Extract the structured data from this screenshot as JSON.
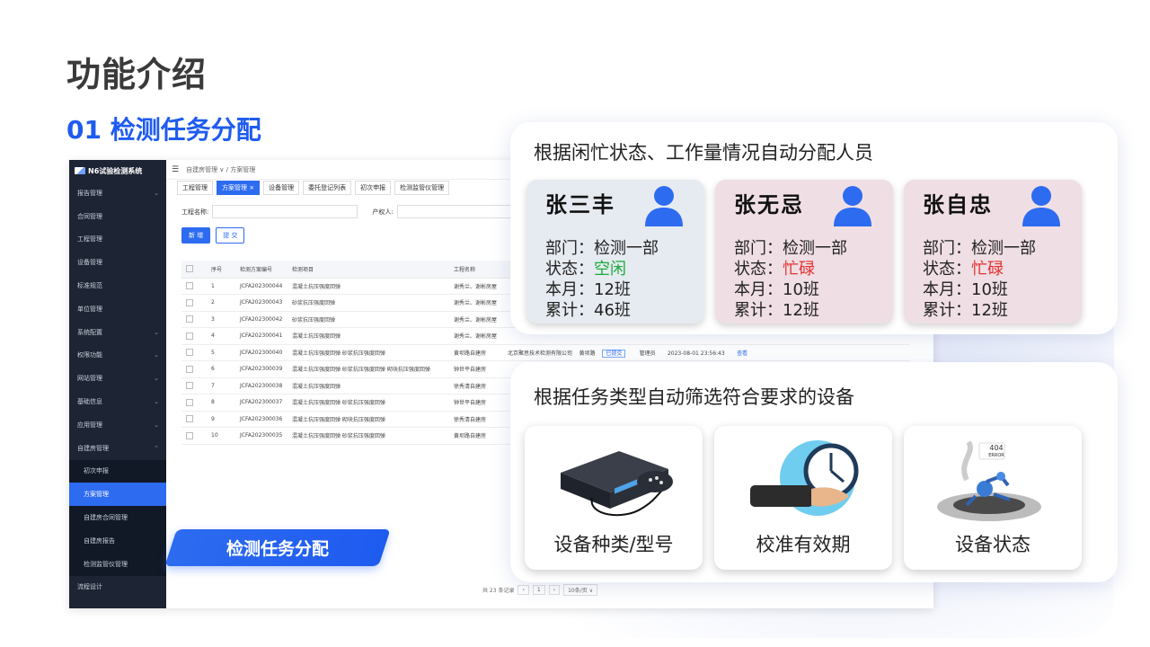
{
  "page_title": "功能介绍",
  "section_title": "01 检测任务分配",
  "ribbon_label": "检测任务分配",
  "app": {
    "logo": "N6试验检测系统",
    "menu": [
      {
        "label": "报告管理",
        "caret": "⌄"
      },
      {
        "label": "合同管理",
        "caret": ""
      },
      {
        "label": "工程管理",
        "caret": ""
      },
      {
        "label": "设备管理",
        "caret": ""
      },
      {
        "label": "标准规范",
        "caret": ""
      },
      {
        "label": "单位管理",
        "caret": ""
      },
      {
        "label": "系统配置",
        "caret": "⌄"
      },
      {
        "label": "权限功能",
        "caret": "⌄"
      },
      {
        "label": "网站管理",
        "caret": "⌄"
      },
      {
        "label": "基础信息",
        "caret": "⌄"
      },
      {
        "label": "应用管理",
        "caret": "⌄"
      },
      {
        "label": "自建房管理",
        "caret": "⌃"
      }
    ],
    "submenu": [
      {
        "label": "初次申报"
      },
      {
        "label": "方案管理"
      },
      {
        "label": "自建房合同管理"
      },
      {
        "label": "自建房报告"
      },
      {
        "label": "检测监管仪管理"
      }
    ],
    "last_menu": "流程设计",
    "breadcrumb": "自建房管理 ∨ / 方案管理",
    "tabs": [
      "工程管理",
      "方案管理 ×",
      "设备管理",
      "委托登记列表",
      "初次申报",
      "检测监管仪管理"
    ],
    "filter_label1": "工程名称:",
    "filter_label2": "产权人:",
    "btn_add": "新 增",
    "btn_submit": "提 交",
    "columns": [
      "序号",
      "检测方案编号",
      "检测项目",
      "工程名称"
    ],
    "rows": [
      {
        "no": "1",
        "code": "JCFA202300044",
        "item": "混凝土抗压强度回弹",
        "project": "谢秀兰、谢彬房屋"
      },
      {
        "no": "2",
        "code": "JCFA202300043",
        "item": "砂浆抗压强度回弹",
        "project": "谢秀兰、谢彬房屋"
      },
      {
        "no": "3",
        "code": "JCFA202300042",
        "item": "砂浆抗压强度回弹",
        "project": "谢秀兰、谢彬房屋"
      },
      {
        "no": "4",
        "code": "JCFA202300041",
        "item": "混凝土抗压强度回弹",
        "project": "谢秀兰、谢彬房屋"
      },
      {
        "no": "5",
        "code": "JCFA202300040",
        "item": "混凝土抗压强度回弹 砂浆抗压强度回弹",
        "project": "黄坝路自建房",
        "company": "北京聚思技术检测有限公司",
        "owner": "黄坝路",
        "status": "已提交",
        "user": "管理员",
        "time": "2023-08-01 23:56:43",
        "op": "查看"
      },
      {
        "no": "6",
        "code": "JCFA202300039",
        "item": "混凝土抗压强度回弹 砂浆抗压强度回弹 砌块抗压强度回弹",
        "project": "钟世平自建房"
      },
      {
        "no": "7",
        "code": "JCFA202300038",
        "item": "混凝土抗压强度回弹",
        "project": "徐秀清自建房"
      },
      {
        "no": "8",
        "code": "JCFA202300037",
        "item": "混凝土抗压强度回弹 砂浆抗压强度回弹",
        "project": "钟世平自建房"
      },
      {
        "no": "9",
        "code": "JCFA202300036",
        "item": "混凝土抗压强度回弹 砌块抗压强度回弹",
        "project": "徐秀清自建房"
      },
      {
        "no": "10",
        "code": "JCFA202300035",
        "item": "混凝土抗压强度回弹 砂浆抗压强度回弹",
        "project": "黄坝路自建房"
      }
    ],
    "pager_total": "共 23 条记录",
    "pager_page": "1",
    "pager_size": "10条/页 ∨"
  },
  "assign": {
    "heading": "根据闲忙状态、工作量情况自动分配人员",
    "people": [
      {
        "name": "张三丰",
        "dept_label": "部门：",
        "dept": "检测一部",
        "status_label": "状态：",
        "status": "空闲",
        "month_label": "本月：",
        "month": "12班",
        "total_label": "累计：",
        "total": "46班"
      },
      {
        "name": "张无忌",
        "dept_label": "部门：",
        "dept": "检测一部",
        "status_label": "状态：",
        "status": "忙碌",
        "month_label": "本月：",
        "month": "10班",
        "total_label": "累计：",
        "total": "12班"
      },
      {
        "name": "张自忠",
        "dept_label": "部门：",
        "dept": "检测一部",
        "status_label": "状态：",
        "status": "忙碌",
        "month_label": "本月：",
        "month": "10班",
        "total_label": "累计：",
        "total": "12班"
      }
    ]
  },
  "equipment": {
    "heading": "根据任务类型自动筛选符合要求的设备",
    "cards": [
      {
        "label": "设备种类/型号",
        "icon": "device-icon"
      },
      {
        "label": "校准有效期",
        "icon": "clock-icon"
      },
      {
        "label": "设备状态",
        "icon": "robot-error-icon",
        "badge": "404",
        "badge_sub": "ERROR"
      }
    ]
  },
  "colors": {
    "accent": "#1e5bf0",
    "free": "#1aaa3b",
    "busy": "#e53030",
    "sidebar": "#1d2433"
  }
}
